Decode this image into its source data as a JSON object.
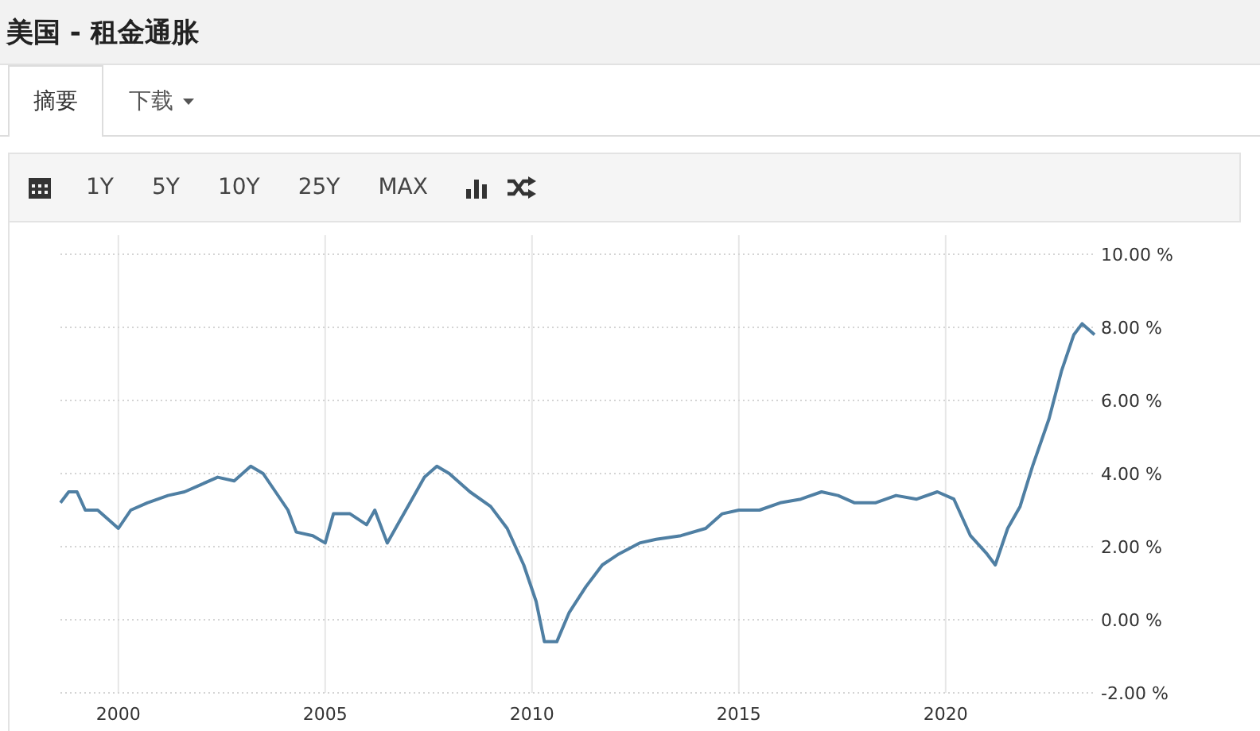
{
  "title": "美国 - 租金通胀",
  "tabs": [
    {
      "label": "摘要",
      "selected": true
    },
    {
      "label": "下载",
      "selected": false,
      "dropdown": true
    }
  ],
  "toolbar": {
    "ranges": [
      "1Y",
      "5Y",
      "10Y",
      "25Y",
      "MAX"
    ]
  },
  "chart": {
    "chart_data": {
      "type": "line",
      "grid": true,
      "xlim": [
        1998.6,
        2023.6
      ],
      "ylim": [
        -2,
        10
      ],
      "xticks": [
        2000,
        2005,
        2010,
        2015,
        2020
      ],
      "yticks": [
        {
          "value": 10,
          "label": "10.00 %"
        },
        {
          "value": 8,
          "label": "8.00 %"
        },
        {
          "value": 6,
          "label": "6.00 %"
        },
        {
          "value": 4,
          "label": "4.00 %"
        },
        {
          "value": 2,
          "label": "2.00 %"
        },
        {
          "value": 0,
          "label": "0.00 %"
        },
        {
          "value": -2,
          "label": "-2.00 %"
        }
      ],
      "x": [
        1998.6,
        1998.8,
        1999.0,
        1999.2,
        1999.5,
        1999.8,
        2000.0,
        2000.3,
        2000.7,
        2001.2,
        2001.6,
        2002.0,
        2002.4,
        2002.8,
        2003.2,
        2003.5,
        2003.8,
        2004.1,
        2004.3,
        2004.7,
        2005.0,
        2005.2,
        2005.6,
        2006.0,
        2006.2,
        2006.5,
        2006.8,
        2007.1,
        2007.4,
        2007.7,
        2008.0,
        2008.5,
        2009.0,
        2009.4,
        2009.8,
        2010.1,
        2010.3,
        2010.6,
        2010.9,
        2011.3,
        2011.7,
        2012.1,
        2012.6,
        2013.0,
        2013.6,
        2014.2,
        2014.6,
        2015.0,
        2015.5,
        2016.0,
        2016.5,
        2017.0,
        2017.4,
        2017.8,
        2018.3,
        2018.8,
        2019.3,
        2019.8,
        2020.2,
        2020.6,
        2021.0,
        2021.2,
        2021.5,
        2021.8,
        2022.1,
        2022.5,
        2022.8,
        2023.1,
        2023.3,
        2023.6
      ],
      "series": [
        {
          "color": "#4f7fa3",
          "values": [
            3.2,
            3.5,
            3.5,
            3.0,
            3.0,
            2.7,
            2.5,
            3.0,
            3.2,
            3.4,
            3.5,
            3.7,
            3.9,
            3.8,
            4.2,
            4.0,
            3.5,
            3.0,
            2.4,
            2.3,
            2.1,
            2.9,
            2.9,
            2.6,
            3.0,
            2.1,
            2.7,
            3.3,
            3.9,
            4.2,
            4.0,
            3.5,
            3.1,
            2.5,
            1.5,
            0.5,
            -0.6,
            -0.6,
            0.2,
            0.9,
            1.5,
            1.8,
            2.1,
            2.2,
            2.3,
            2.5,
            2.9,
            3.0,
            3.0,
            3.2,
            3.3,
            3.5,
            3.4,
            3.2,
            3.2,
            3.4,
            3.3,
            3.5,
            3.3,
            2.3,
            1.8,
            1.5,
            2.5,
            3.1,
            4.2,
            5.5,
            6.8,
            7.8,
            8.1,
            7.8
          ]
        }
      ]
    }
  }
}
